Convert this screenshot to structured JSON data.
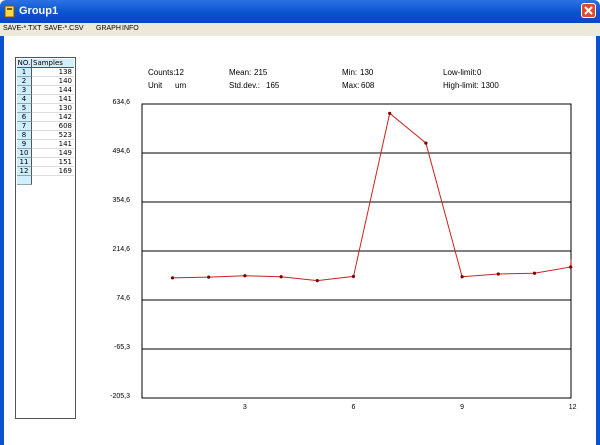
{
  "window": {
    "title": "Group1"
  },
  "menu": [
    "SAVE-*.TXT",
    "SAVE-*.CSV",
    "GRAPH",
    "INFO"
  ],
  "table": {
    "headers": {
      "no": "NO.",
      "samples": "Samples"
    },
    "rows": [
      {
        "no": "1",
        "value": "138"
      },
      {
        "no": "2",
        "value": "140"
      },
      {
        "no": "3",
        "value": "144"
      },
      {
        "no": "4",
        "value": "141"
      },
      {
        "no": "5",
        "value": "130"
      },
      {
        "no": "6",
        "value": "142"
      },
      {
        "no": "7",
        "value": "608"
      },
      {
        "no": "8",
        "value": "523"
      },
      {
        "no": "9",
        "value": "141"
      },
      {
        "no": "10",
        "value": "149"
      },
      {
        "no": "11",
        "value": "151"
      },
      {
        "no": "12",
        "value": "169"
      }
    ]
  },
  "stats": {
    "counts_label": "Counts:",
    "counts_value": "12",
    "unit_label": "Unit",
    "unit_value": "um",
    "mean_label": "Mean:",
    "mean_value": "215",
    "stddev_label": "Std.dev.:",
    "stddev_value": "165",
    "min_label": "Min:",
    "min_value": "130",
    "max_label": "Max:",
    "max_value": "608",
    "lowlimit_label": "Low-limit:",
    "lowlimit_value": "0",
    "highlimit_label": "High-limit:",
    "highlimit_value": "1300"
  },
  "chart_data": {
    "type": "line",
    "x": [
      1,
      2,
      3,
      4,
      5,
      6,
      7,
      8,
      9,
      10,
      11,
      12,
      13
    ],
    "values": [
      138,
      140,
      144,
      141,
      130,
      142,
      608,
      523,
      141,
      149,
      151,
      169,
      190
    ],
    "y_ticks": [
      "634,6",
      "494,6",
      "354,6",
      "214,6",
      "74,6",
      "-65,3",
      "-205,3"
    ],
    "ylim": [
      -205.3,
      634.6
    ],
    "x_ticks": [
      "3",
      "6",
      "9",
      "12"
    ],
    "line_color": "#cc2222",
    "grid": true
  }
}
